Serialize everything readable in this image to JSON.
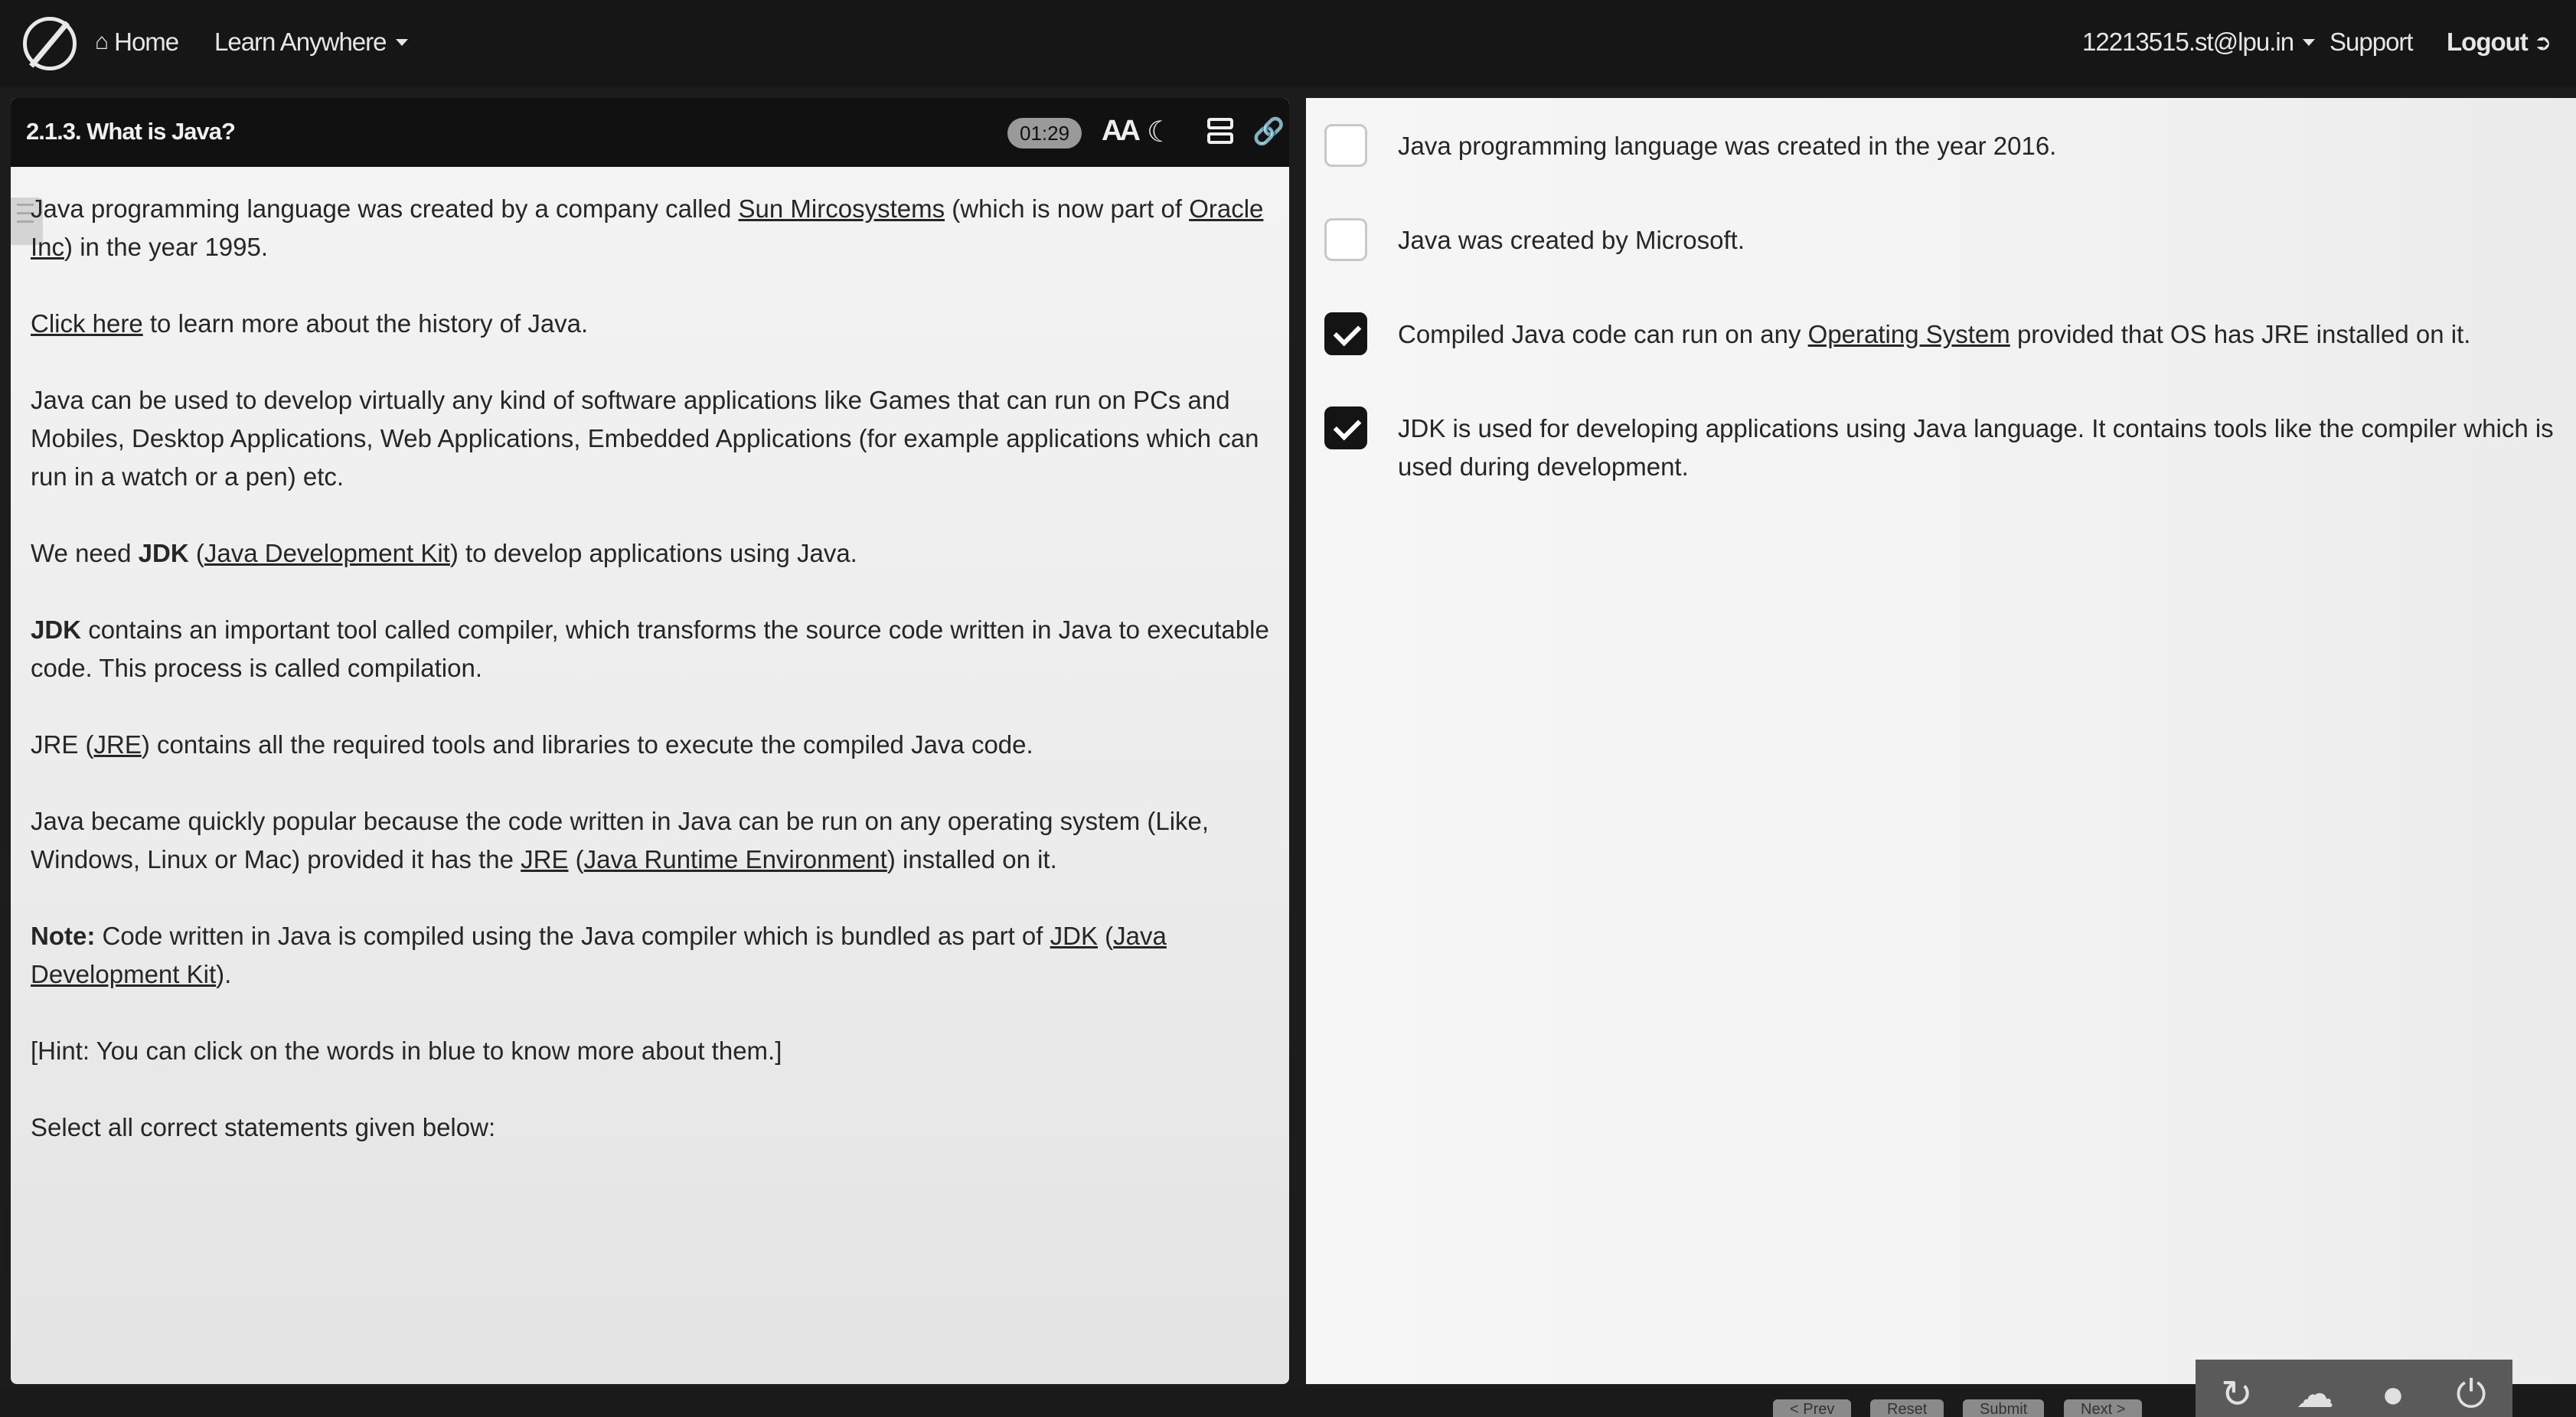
{
  "navbar": {
    "home": "Home",
    "learn": "Learn Anywhere",
    "user": "12213515.st@lpu.in",
    "support": "Support",
    "logout": "Logout"
  },
  "lesson": {
    "title": "2.1.3. What is Java?",
    "timer": "01:29",
    "paragraphs": {
      "p1": {
        "t1": "Java programming language was created by a company called ",
        "link1": "Sun Mircosystems",
        "t2": " (which is now part of ",
        "link2": "Oracle Inc",
        "t3": ") in the year 1995."
      },
      "p2": {
        "link": "Click here",
        "t": " to learn more about the history of Java."
      },
      "p3": "Java can be used to develop virtually any kind of software applications like Games that can run on PCs and Mobiles, Desktop Applications, Web Applications, Embedded Applications (for example applications which can run in a watch or a pen) etc.",
      "p4": {
        "t1": "We need ",
        "b": "JDK",
        "t2": " (",
        "link": "Java Development Kit",
        "t3": ") to develop applications using Java."
      },
      "p5": {
        "b": "JDK",
        "t": " contains an important tool called compiler, which transforms the source code written in Java to executable code. This process is called compilation."
      },
      "p6": {
        "t1": "JRE (",
        "link": "JRE",
        "t2": ") contains all the required tools and libraries to execute the compiled Java code."
      },
      "p7": {
        "t1": "Java became quickly popular because the code written in Java can be run on any operating system (Like, Windows, Linux or Mac) provided it has the ",
        "link1": "JRE",
        "t2": " (",
        "link2": "Java Runtime Environment",
        "t3": ") installed on it."
      },
      "p8": {
        "b": "Note:",
        "t1": " Code written in Java is compiled using the Java compiler which is bundled as part of ",
        "link1": "JDK",
        "t2": " (",
        "link2": "Java Development Kit",
        "t3": ")."
      },
      "p9": "[Hint: You can click on the words in blue to know more about them.]",
      "p10": "Select all correct statements given below:"
    }
  },
  "options": [
    {
      "text": "Java programming language was created in the year 2016.",
      "checked": false
    },
    {
      "text": "Java was created by Microsoft.",
      "checked": false
    },
    {
      "t1": "Compiled Java code can run on any ",
      "link": "Operating System",
      "t2": " provided that OS has JRE installed on it.",
      "checked": true
    },
    {
      "text": "JDK is used for developing applications using Java language. It contains tools like the compiler which is used during development.",
      "checked": true
    }
  ],
  "bottom": {
    "prev": "< Prev",
    "reset": "Reset",
    "submit": "Submit",
    "next": "Next >"
  }
}
